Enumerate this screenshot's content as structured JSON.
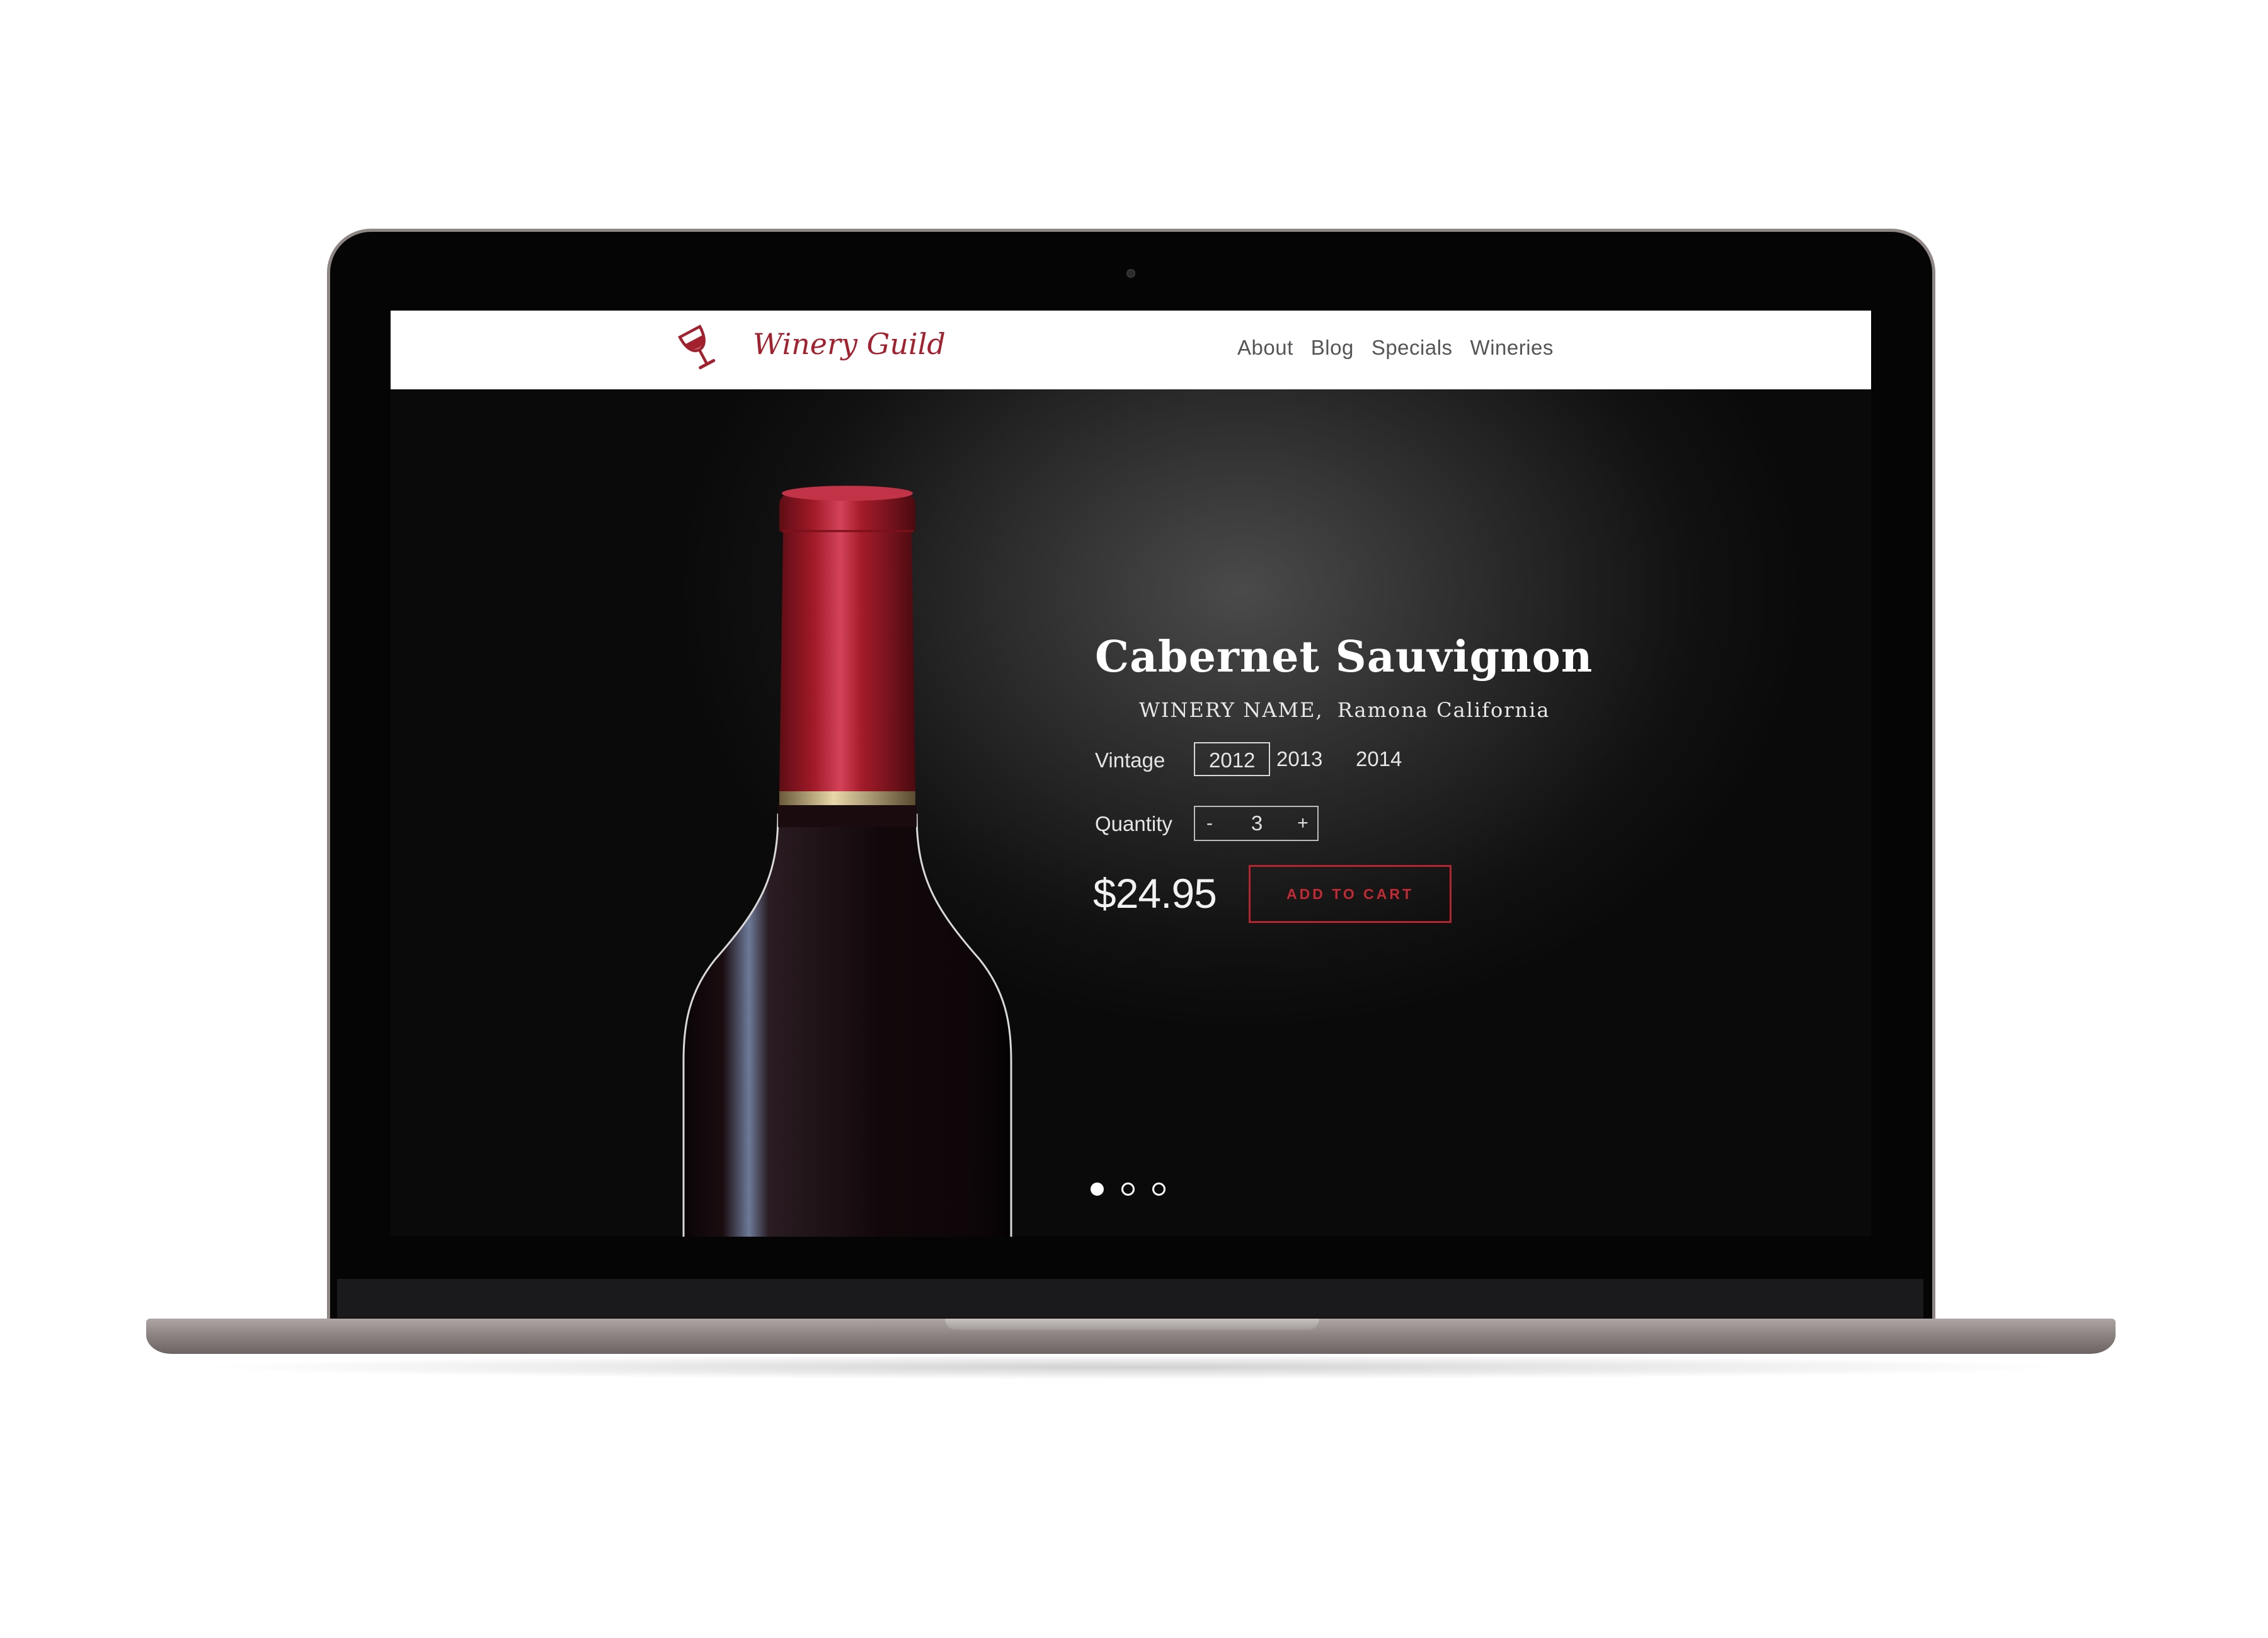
{
  "header": {
    "brand": "Winery Guild",
    "nav": [
      "About",
      "Blog",
      "Specials",
      "Wineries"
    ]
  },
  "product": {
    "name": "Cabernet Sauvignon",
    "winery": "WINERY NAME,",
    "location": "Ramona California",
    "vintage_label": "Vintage",
    "vintages": [
      "2012",
      "2013",
      "2014"
    ],
    "selected_vintage": "2012",
    "quantity_label": "Quantity",
    "quantity_minus": "-",
    "quantity": "3",
    "quantity_plus": "+",
    "price": "$24.95",
    "cart_label": "ADD TO CART"
  },
  "carousel": {
    "slide_count": 3,
    "active_index": 0
  },
  "colors": {
    "brand_red": "#a3212e",
    "button_red": "#c42a33",
    "nav_text": "#555555"
  }
}
